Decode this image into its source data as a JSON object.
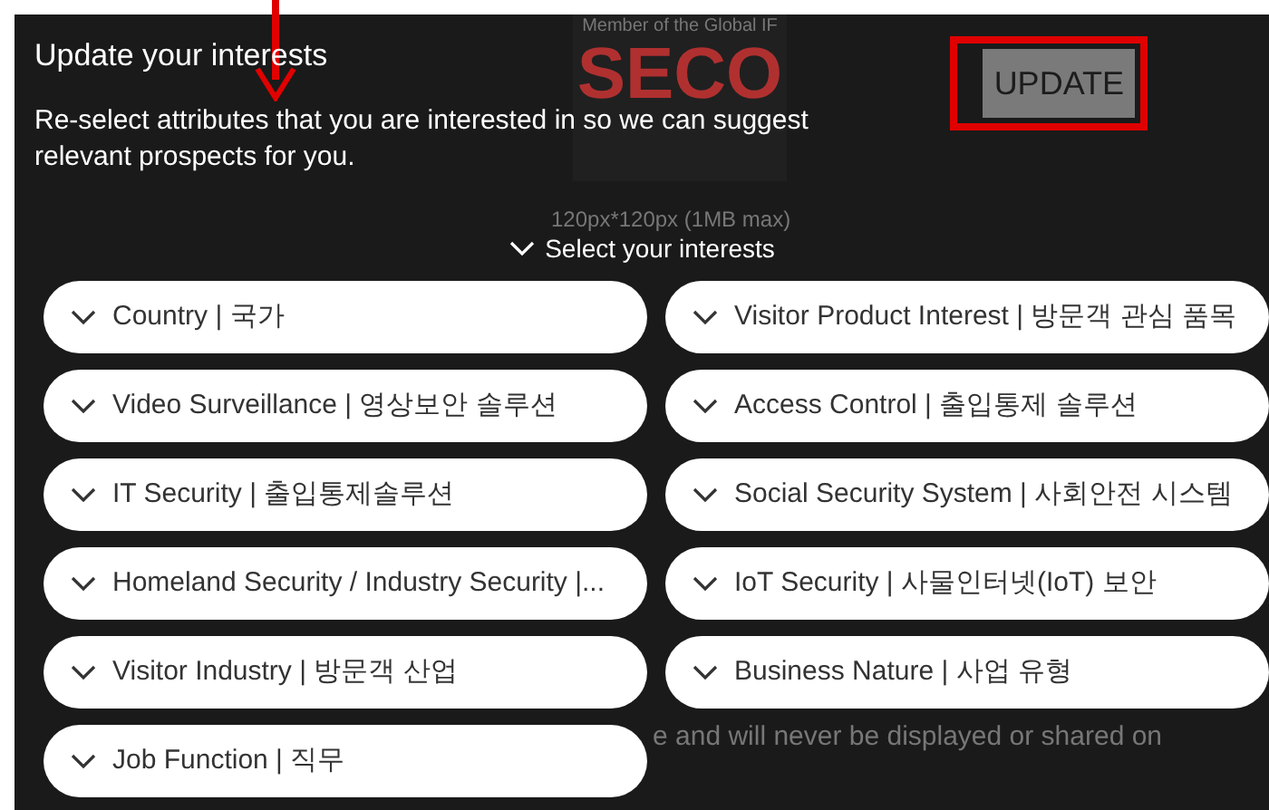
{
  "background": {
    "logo_caption": "Member of the Global IF",
    "logo_text": "SECO",
    "size_hint": "120px*120px (1MB max)",
    "footer_fragment": "e and will never be displayed or shared on"
  },
  "dialog": {
    "title": "Update your interests",
    "description": "Re-select attributes that you are interested in so we can suggest relevant prospects for you.",
    "update_button": "UPDATE",
    "section_toggle": "Select your interests",
    "dropdowns": [
      {
        "label": "Country | 국가",
        "expanded": false
      },
      {
        "label": "Visitor Product Interest | 방문객 관심 품목",
        "expanded": false
      },
      {
        "label": "Video Surveillance | 영상보안 솔루션",
        "expanded": false
      },
      {
        "label": "Access Control | 출입통제 솔루션",
        "expanded": false
      },
      {
        "label": "IT Security | 출입통제솔루션",
        "expanded": false
      },
      {
        "label": "Social Security System | 사회안전 시스템",
        "expanded": false
      },
      {
        "label": "Homeland Security / Industry Security |...",
        "expanded": false
      },
      {
        "label": "IoT Security | 사물인터넷(IoT) 보안",
        "expanded": false
      },
      {
        "label": "Visitor Industry | 방문객 산업",
        "expanded": false
      },
      {
        "label": "Business Nature | 사업 유형",
        "expanded": false
      },
      {
        "label": "Job Function | 직무",
        "expanded": false
      }
    ]
  }
}
